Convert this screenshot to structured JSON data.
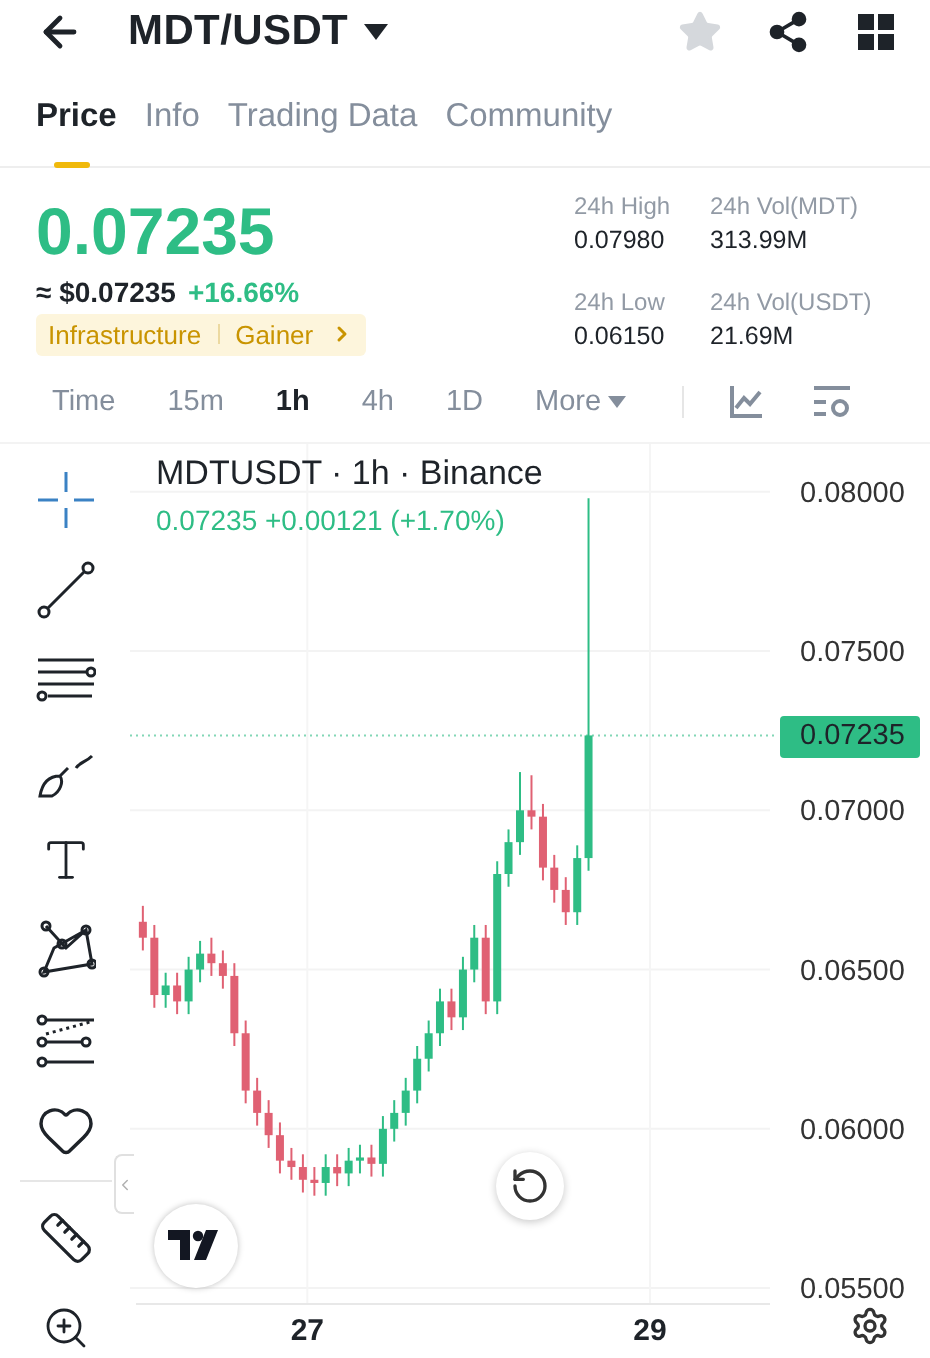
{
  "header": {
    "title": "MDT/USDT",
    "favorite": false
  },
  "tabs": [
    {
      "label": "Price",
      "selected": true
    },
    {
      "label": "Info",
      "selected": false
    },
    {
      "label": "Trading Data",
      "selected": false
    },
    {
      "label": "Community",
      "selected": false
    }
  ],
  "price": {
    "last": "0.07235",
    "usd": "≈ $0.07235",
    "change": "+16.66%",
    "tags": [
      "Infrastructure",
      "Gainer"
    ]
  },
  "stats": [
    {
      "label": "24h High",
      "value": "0.07980"
    },
    {
      "label": "24h Vol(MDT)",
      "value": "313.99M"
    },
    {
      "label": "24h Low",
      "value": "0.06150"
    },
    {
      "label": "24h Vol(USDT)",
      "value": "21.69M"
    }
  ],
  "intervals": [
    {
      "label": "Time",
      "selected": false,
      "kind": "option"
    },
    {
      "label": "15m",
      "selected": false,
      "kind": "option"
    },
    {
      "label": "1h",
      "selected": true,
      "kind": "option"
    },
    {
      "label": "4h",
      "selected": false,
      "kind": "option"
    },
    {
      "label": "1D",
      "selected": false,
      "kind": "option"
    },
    {
      "label": "More",
      "selected": false,
      "kind": "menu"
    }
  ],
  "chart": {
    "legend": "0.07235 +0.00121 (+1.70%)",
    "chart_data": {
      "type": "candlestick",
      "title": "MDTUSDT · 1h · Binance",
      "grid": true,
      "xlim": [
        26.0,
        29.7
      ],
      "ylim": [
        0.0545,
        0.0815
      ],
      "ref_lines": [
        {
          "axis": "y",
          "value": 0.07235,
          "label": "0.07235"
        }
      ],
      "x": [
        26.04,
        26.107,
        26.173,
        26.24,
        26.307,
        26.374,
        26.44,
        26.507,
        26.574,
        26.64,
        26.707,
        26.774,
        26.84,
        26.907,
        26.974,
        27.041,
        27.107,
        27.174,
        27.241,
        27.307,
        27.374,
        27.441,
        27.507,
        27.574,
        27.641,
        27.708,
        27.774,
        27.841,
        27.908,
        27.974,
        28.041,
        28.108,
        28.174,
        28.241,
        28.308,
        28.375,
        28.441,
        28.508,
        28.575,
        28.641
      ],
      "xticks": [
        27,
        29
      ],
      "yticks": [
        {
          "value": 0.08,
          "label": "0.08000"
        },
        {
          "value": 0.075,
          "label": "0.07500"
        },
        {
          "value": 0.07,
          "label": "0.07000"
        },
        {
          "value": 0.065,
          "label": "0.06500"
        },
        {
          "value": 0.06,
          "label": "0.06000"
        },
        {
          "value": 0.055,
          "label": "0.05500"
        }
      ],
      "ohlc": [
        [
          0.0665,
          0.067,
          0.0656,
          0.066
        ],
        [
          0.066,
          0.0664,
          0.0638,
          0.0642
        ],
        [
          0.0642,
          0.0649,
          0.0638,
          0.0645
        ],
        [
          0.0645,
          0.0649,
          0.0636,
          0.064
        ],
        [
          0.064,
          0.0654,
          0.0636,
          0.065
        ],
        [
          0.065,
          0.0659,
          0.0646,
          0.0655
        ],
        [
          0.0655,
          0.066,
          0.0648,
          0.0652
        ],
        [
          0.0652,
          0.0656,
          0.0644,
          0.0648
        ],
        [
          0.0648,
          0.0652,
          0.0626,
          0.063
        ],
        [
          0.063,
          0.0634,
          0.0608,
          0.0612
        ],
        [
          0.0612,
          0.0616,
          0.0601,
          0.0605
        ],
        [
          0.0605,
          0.0609,
          0.0594,
          0.0598
        ],
        [
          0.0598,
          0.0602,
          0.0586,
          0.059
        ],
        [
          0.059,
          0.0594,
          0.0584,
          0.0588
        ],
        [
          0.0588,
          0.0592,
          0.058,
          0.0584
        ],
        [
          0.0584,
          0.0588,
          0.0579,
          0.0583
        ],
        [
          0.0583,
          0.0592,
          0.0579,
          0.0588
        ],
        [
          0.0588,
          0.0592,
          0.0582,
          0.0586
        ],
        [
          0.0586,
          0.0594,
          0.0582,
          0.059
        ],
        [
          0.059,
          0.0595,
          0.0586,
          0.0591
        ],
        [
          0.0591,
          0.0595,
          0.0585,
          0.0589
        ],
        [
          0.0589,
          0.0604,
          0.0585,
          0.06
        ],
        [
          0.06,
          0.0609,
          0.0596,
          0.0605
        ],
        [
          0.0605,
          0.0616,
          0.0601,
          0.0612
        ],
        [
          0.0612,
          0.0626,
          0.0608,
          0.0622
        ],
        [
          0.0622,
          0.0634,
          0.0618,
          0.063
        ],
        [
          0.063,
          0.0644,
          0.0626,
          0.064
        ],
        [
          0.064,
          0.0644,
          0.0631,
          0.0635
        ],
        [
          0.0635,
          0.0654,
          0.0631,
          0.065
        ],
        [
          0.065,
          0.0664,
          0.0646,
          0.066
        ],
        [
          0.066,
          0.0664,
          0.0636,
          0.064
        ],
        [
          0.064,
          0.0684,
          0.0636,
          0.068
        ],
        [
          0.068,
          0.0694,
          0.0676,
          0.069
        ],
        [
          0.069,
          0.0712,
          0.0686,
          0.07
        ],
        [
          0.07,
          0.0711,
          0.0694,
          0.0698
        ],
        [
          0.0698,
          0.0702,
          0.0678,
          0.0682
        ],
        [
          0.0682,
          0.0686,
          0.0671,
          0.0675
        ],
        [
          0.0675,
          0.0679,
          0.0664,
          0.0668
        ],
        [
          0.0668,
          0.0689,
          0.0664,
          0.0685
        ],
        [
          0.0685,
          0.0798,
          0.0681,
          0.07235
        ]
      ]
    }
  }
}
